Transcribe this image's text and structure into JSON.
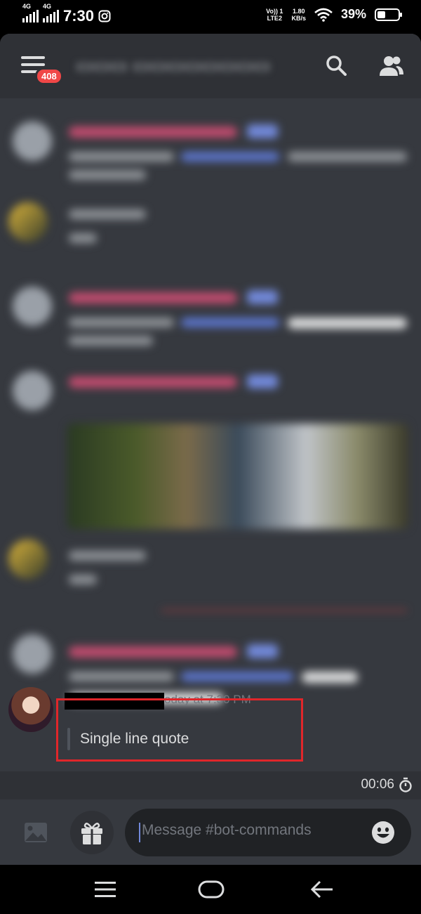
{
  "status_bar": {
    "network_1": "4G",
    "network_2": "4G",
    "time": "7:30",
    "volte_line1": "Vo)) 1",
    "volte_line2": "LTE2",
    "speed_value": "1.80",
    "speed_unit": "KB/s",
    "battery": "39%",
    "battery_level": 0.39
  },
  "header": {
    "badge": "408"
  },
  "message": {
    "timestamp": "oday at 7:30 PM",
    "quote_text": "Single line quote"
  },
  "timer": "00:06",
  "composer": {
    "placeholder": "Message #bot-commands"
  },
  "colors": {
    "background": "#36393f",
    "header": "#2f3136",
    "highlight_box": "#e0262a",
    "badge": "#f04747",
    "accent": "#7289da"
  }
}
